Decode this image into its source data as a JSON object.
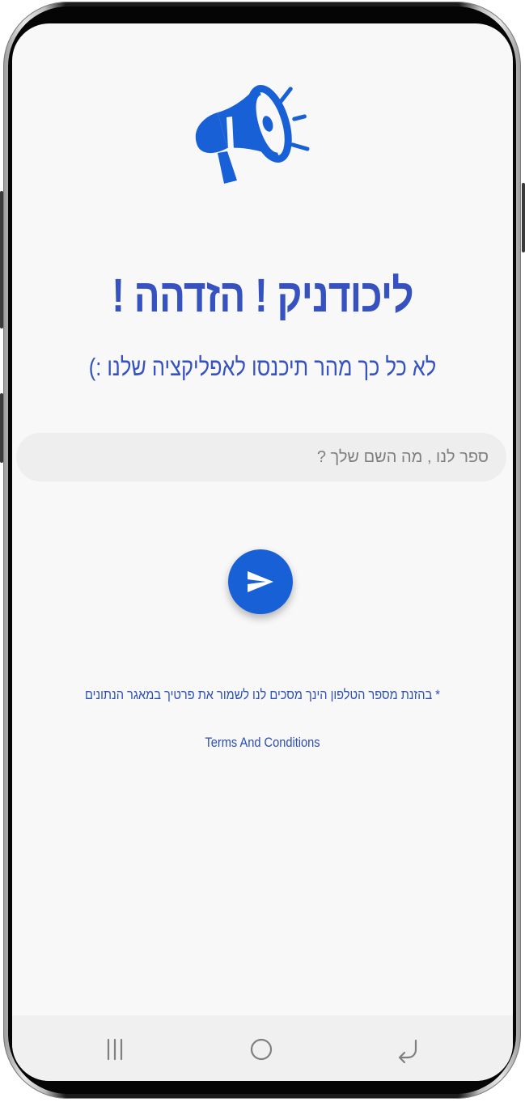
{
  "header": {
    "icon": "megaphone-icon"
  },
  "welcome": {
    "title": "ליכודניק ! הזדהה !",
    "subtitle": "לא כל כך מהר תיכנסו לאפליקציה שלנו :)"
  },
  "form": {
    "name_placeholder": "ספר לנו , מה השם שלך ?",
    "name_value": "",
    "submit_icon": "send-icon"
  },
  "footer": {
    "consent_text": "* בהזנת מספר הטלפון הינך מסכים לנו לשמור את פרטיך במאגר הנתונים",
    "terms_link": "Terms And Conditions"
  },
  "navigation_bar": {
    "recents_icon": "recents-icon",
    "home_icon": "home-icon",
    "back_icon": "back-icon"
  },
  "colors": {
    "accent": "#1860d6",
    "title_text": "#3652c0",
    "screen_background": "#f8f8f8",
    "input_background": "#eeeeee",
    "nav_background": "#f0f0f0"
  }
}
